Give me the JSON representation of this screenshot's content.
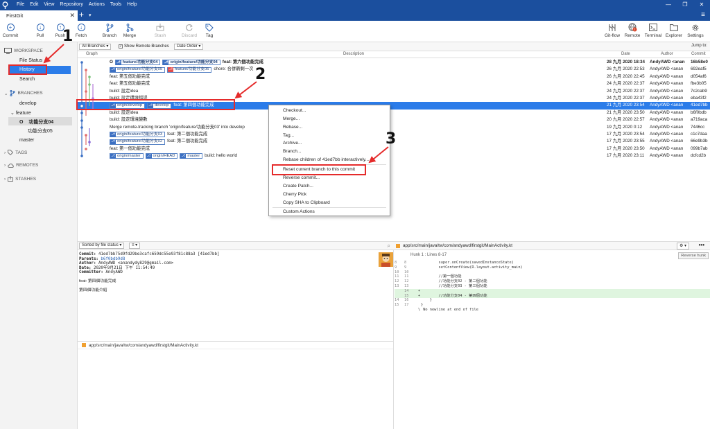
{
  "menubar": {
    "items": [
      "File",
      "Edit",
      "View",
      "Repository",
      "Actions",
      "Tools",
      "Help"
    ]
  },
  "tab": {
    "title": "FirstGit",
    "close": "✕"
  },
  "toolbar": {
    "commit": "Commit",
    "pull": "Pull",
    "push": "Push",
    "fetch": "Fetch",
    "branch": "Branch",
    "merge": "Merge",
    "stash": "Stash",
    "discard": "Discard",
    "tag": "Tag",
    "gitflow": "Git-flow",
    "remote": "Remote",
    "terminal": "Terminal",
    "explorer": "Explorer",
    "settings": "Settings"
  },
  "sidebar": {
    "workspace": "WORKSPACE",
    "file_status": "File Status",
    "history": "History",
    "search": "Search",
    "branches": "BRANCHES",
    "develop": "develop",
    "feature": "feature",
    "feature_items": [
      "功能分支04",
      "功能分支05"
    ],
    "master": "master",
    "tags": "TAGS",
    "remotes": "REMOTES",
    "stashes": "STASHES"
  },
  "filterbar": {
    "all_branches": "All Branches ▾",
    "show_remote": "Show Remote Branches",
    "date_order": "Date Order ▾",
    "jump_to": "Jump to:"
  },
  "columns": {
    "graph": "Graph",
    "description": "Description",
    "date": "Date",
    "author": "Author",
    "commit": "Commit"
  },
  "commits": [
    {
      "badges": [
        [
          "feature/功能分支04",
          "b"
        ],
        [
          "origin/feature/功能分支04",
          "b"
        ]
      ],
      "msg": "feat: 第六個功能完成",
      "date": "28 九月 2020 18:34",
      "author": "AndyAWD <anan",
      "hash": "16b58e0",
      "bold": true
    },
    {
      "badges": [
        [
          "origin/feature/功能分支05",
          "b"
        ],
        [
          "feature/功能分支05",
          "r"
        ]
      ],
      "msg": "chore: 合併齁剩一次",
      "date": "26 九月 2020 22:53",
      "author": "AndyAWD <anan",
      "hash": "692eaf5"
    },
    {
      "badges": [],
      "msg": "feat: 第五個功能完成",
      "date": "26 九月 2020 22:45",
      "author": "AndyAWD <anan",
      "hash": "d054af6"
    },
    {
      "badges": [],
      "msg": "feat: 第五個功能完成",
      "date": "24 九月 2020 22:37",
      "author": "AndyAWD <anan",
      "hash": "fbe3b05"
    },
    {
      "badges": [],
      "msg": "build: 設定idea",
      "date": "24 九月 2020 22:37",
      "author": "AndyAWD <anan",
      "hash": "7c2cab9"
    },
    {
      "badges": [],
      "msg": "build: 設定環境錯誤",
      "date": "24 九月 2020 22:37",
      "author": "AndyAWD <anan",
      "hash": "eba43f2"
    },
    {
      "badges": [
        [
          "origin/develop",
          "b"
        ],
        [
          "develop",
          "b"
        ]
      ],
      "msg": "feat: 第四個功能完成",
      "date": "21 九月 2020 23:54",
      "author": "AndyAWD <anan",
      "hash": "41ed7bb",
      "selected": true
    },
    {
      "badges": [],
      "msg": "build: 設定idea",
      "date": "21 九月 2020 23:50",
      "author": "AndyAWD <anan",
      "hash": "b6f0bdb"
    },
    {
      "badges": [],
      "msg": "build: 設定環境變數",
      "date": "20 九月 2020 22:57",
      "author": "AndyAWD <anan",
      "hash": "a719aca"
    },
    {
      "badges": [],
      "msg": "Merge remote-tracking branch 'origin/feature/功能分支03' into develop",
      "date": "19 九月 2020 0:12",
      "author": "AndyAWD <anan",
      "hash": "7446cc"
    },
    {
      "badges": [
        [
          "origin/feature/功能分支03",
          "b"
        ]
      ],
      "msg": "feat: 第二個功能完成",
      "date": "17 九月 2020 23:54",
      "author": "AndyAWD <anan",
      "hash": "c1c7daa"
    },
    {
      "badges": [
        [
          "origin/feature/功能分支02",
          "b"
        ]
      ],
      "msg": "feat: 第二個功能完成",
      "date": "17 九月 2020 23:55",
      "author": "AndyAWD <anan",
      "hash": "66e9b3b"
    },
    {
      "badges": [],
      "msg": "feat: 第一個功能完成",
      "date": "17 九月 2020 23:50",
      "author": "AndyAWD <anan",
      "hash": "099b7ab"
    },
    {
      "badges": [
        [
          "origin/master",
          "b"
        ],
        [
          "origin/HEAD",
          "b"
        ],
        [
          "master",
          "b"
        ]
      ],
      "msg": "build: hello world",
      "date": "17 九月 2020 23:11",
      "author": "AndyAWD <anan",
      "hash": "dcfcd2b"
    }
  ],
  "context_menu": {
    "items": [
      "Checkout...",
      "Merge...",
      "Rebase...",
      "Tag...",
      "Archive...",
      "Branch...",
      "Rebase children of 41ed7bb interactively...",
      "Reset current branch to this commit",
      "Reverse commit...",
      "Create Patch...",
      "Cherry Pick",
      "Copy SHA to Clipboard",
      "Custom Actions"
    ]
  },
  "annotations": {
    "one": "1",
    "two": "2",
    "three": "3"
  },
  "bottom_left": {
    "sort": "Sorted by file status ▾",
    "commit_label": "Commit:",
    "commit_value": "41ed7bb75d9fd29be3cafc659dc55e93f81c88a3 [41ed7bb]",
    "parents_label": "Parents:",
    "parents_value": "b6f0bdb9d8",
    "author_label": "Author:",
    "author_value": "AndyAWD <anandydy829@gmail.com>",
    "date_label": "Date:",
    "date_value": "2020年9月21日 下午 11:54:49",
    "committer_label": "Committer:",
    "committer_value": "AndyAWD",
    "message": "feat: 第四個功能完成",
    "body": "第四個功能介紹",
    "file_path": "app/src/main/java/tw/com/andyawd/firstgit/MainActivity.kt"
  },
  "bottom_right": {
    "file_path": "app/src/main/java/tw/com/andyawd/firstgit/MainActivity.kt",
    "hunk": "Hunk 1 : Lines 8-17",
    "reverse_hunk": "Reverse hunk",
    "lines": [
      {
        "n1": "8",
        "n2": "8",
        "sign": "",
        "text": "        super.onCreate(savedInstanceState)",
        "add": false
      },
      {
        "n1": "9",
        "n2": "9",
        "sign": "",
        "text": "        setContentView(R.layout.activity_main)",
        "add": false
      },
      {
        "n1": "10",
        "n2": "10",
        "sign": "",
        "text": "",
        "add": false
      },
      {
        "n1": "11",
        "n2": "11",
        "sign": "",
        "text": "        //第一個功能",
        "add": false
      },
      {
        "n1": "12",
        "n2": "12",
        "sign": "",
        "text": "        //功能分支02 - 第二個功能",
        "add": false
      },
      {
        "n1": "13",
        "n2": "13",
        "sign": "",
        "text": "        //功能分支03 - 第三個功能",
        "add": false
      },
      {
        "n1": "",
        "n2": "14",
        "sign": "+",
        "text": "",
        "add": true
      },
      {
        "n1": "",
        "n2": "15",
        "sign": "+",
        "text": "        //功能分支04 - 第四個功能",
        "add": true
      },
      {
        "n1": "14",
        "n2": "16",
        "sign": "",
        "text": "    }",
        "add": false
      },
      {
        "n1": "15",
        "n2": "17",
        "sign": "",
        "text": "}",
        "add": false
      },
      {
        "n1": "",
        "n2": "",
        "sign": "\\",
        "text": " No newline at end of file",
        "add": false
      }
    ]
  }
}
